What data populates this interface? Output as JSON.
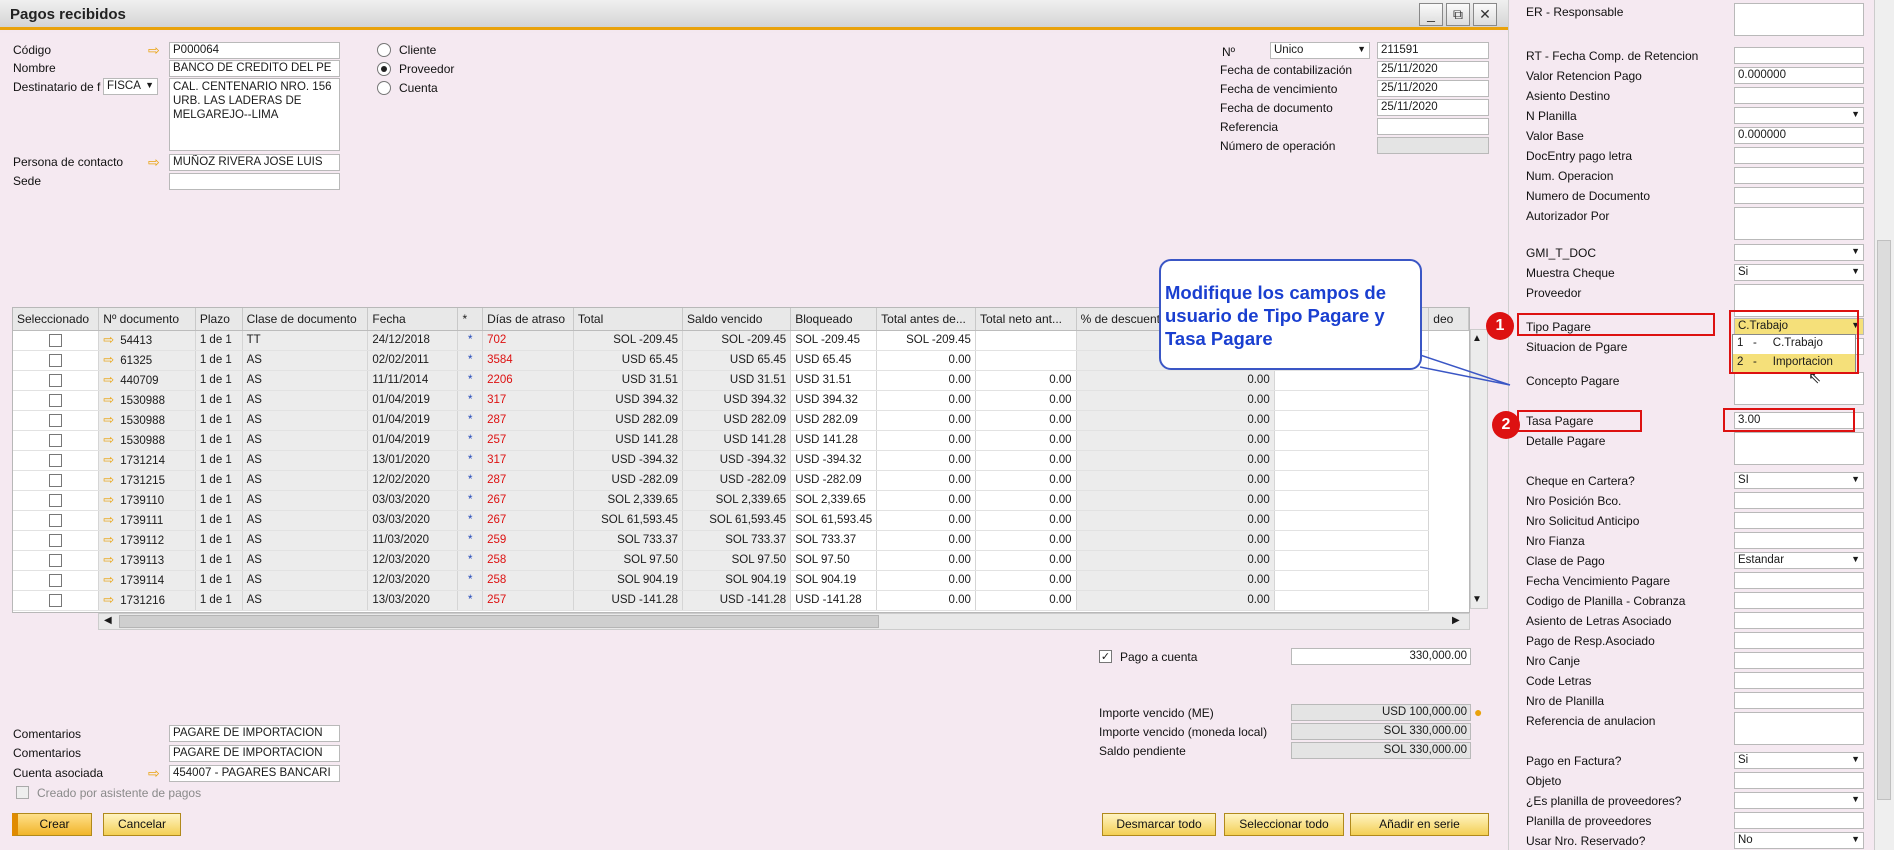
{
  "window": {
    "title": "Pagos recibidos",
    "minimize": "_",
    "restore": "⧉",
    "close": "✕"
  },
  "header_left": {
    "codigo_label": "Código",
    "codigo_value": "P000064",
    "nombre_label": "Nombre",
    "nombre_value": "BANCO DE CREDITO DEL PE",
    "destinatario_label": "Destinatario de f",
    "destinatario_select": "FISCA",
    "address_lines": [
      "CAL. CENTENARIO NRO. 156",
      "URB. LAS LADERAS DE",
      "MELGAREJO--LIMA"
    ],
    "contacto_label": "Persona de contacto",
    "contacto_value": "MUÑOZ RIVERA JOSE LUIS",
    "sede_label": "Sede",
    "sede_value": ""
  },
  "radios": {
    "cliente": "Cliente",
    "proveedor": "Proveedor",
    "cuenta": "Cuenta"
  },
  "header_right": {
    "no_label": "Nº",
    "serie_select": "Unico",
    "no_value": "211591",
    "fecha_contab_label": "Fecha de contabilización",
    "fecha_contab_value": "25/11/2020",
    "fecha_venc_label": "Fecha de vencimiento",
    "fecha_venc_value": "25/11/2020",
    "fecha_doc_label": "Fecha de documento",
    "fecha_doc_value": "25/11/2020",
    "referencia_label": "Referencia",
    "referencia_value": "",
    "num_oper_label": "Número de operación",
    "num_oper_value": ""
  },
  "grid": {
    "headers": [
      "Seleccionado",
      "Nº documento",
      "Plazo",
      "Clase de documento",
      "Fecha",
      "*",
      "Días de atraso",
      "Total",
      "Saldo vencido",
      "Bloqueado",
      "Total antes de...",
      "Total neto ant...",
      "% de descuento",
      "",
      "deo"
    ],
    "rows": [
      [
        "54413",
        "1 de 1",
        "TT",
        "24/12/2018",
        "*",
        "702",
        "SOL -209.45",
        "SOL -209.45",
        "SOL -209.45",
        "SOL -209.45",
        "",
        ""
      ],
      [
        "61325",
        "1 de 1",
        "AS",
        "02/02/2011",
        "*",
        "3584",
        "USD 65.45",
        "USD 65.45",
        "USD 65.45",
        "0.00",
        "",
        "0.00"
      ],
      [
        "440709",
        "1 de 1",
        "AS",
        "11/11/2014",
        "*",
        "2206",
        "USD 31.51",
        "USD 31.51",
        "USD 31.51",
        "0.00",
        "0.00",
        "0.00"
      ],
      [
        "1530988",
        "1 de 1",
        "AS",
        "01/04/2019",
        "*",
        "317",
        "USD 394.32",
        "USD 394.32",
        "USD 394.32",
        "0.00",
        "0.00",
        "0.00"
      ],
      [
        "1530988",
        "1 de 1",
        "AS",
        "01/04/2019",
        "*",
        "287",
        "USD 282.09",
        "USD 282.09",
        "USD 282.09",
        "0.00",
        "0.00",
        "0.00"
      ],
      [
        "1530988",
        "1 de 1",
        "AS",
        "01/04/2019",
        "*",
        "257",
        "USD 141.28",
        "USD 141.28",
        "USD 141.28",
        "0.00",
        "0.00",
        "0.00"
      ],
      [
        "1731214",
        "1 de 1",
        "AS",
        "13/01/2020",
        "*",
        "317",
        "USD -394.32",
        "USD -394.32",
        "USD -394.32",
        "0.00",
        "0.00",
        "0.00"
      ],
      [
        "1731215",
        "1 de 1",
        "AS",
        "12/02/2020",
        "*",
        "287",
        "USD -282.09",
        "USD -282.09",
        "USD -282.09",
        "0.00",
        "0.00",
        "0.00"
      ],
      [
        "1739110",
        "1 de 1",
        "AS",
        "03/03/2020",
        "*",
        "267",
        "SOL 2,339.65",
        "SOL 2,339.65",
        "SOL 2,339.65",
        "0.00",
        "0.00",
        "0.00"
      ],
      [
        "1739111",
        "1 de 1",
        "AS",
        "03/03/2020",
        "*",
        "267",
        "SOL 61,593.45",
        "SOL 61,593.45",
        "SOL 61,593.45",
        "0.00",
        "0.00",
        "0.00"
      ],
      [
        "1739112",
        "1 de 1",
        "AS",
        "11/03/2020",
        "*",
        "259",
        "SOL 733.37",
        "SOL 733.37",
        "SOL 733.37",
        "0.00",
        "0.00",
        "0.00"
      ],
      [
        "1739113",
        "1 de 1",
        "AS",
        "12/03/2020",
        "*",
        "258",
        "SOL 97.50",
        "SOL 97.50",
        "SOL 97.50",
        "0.00",
        "0.00",
        "0.00"
      ],
      [
        "1739114",
        "1 de 1",
        "AS",
        "12/03/2020",
        "*",
        "258",
        "SOL 904.19",
        "SOL 904.19",
        "SOL 904.19",
        "0.00",
        "0.00",
        "0.00"
      ],
      [
        "1731216",
        "1 de 1",
        "AS",
        "13/03/2020",
        "*",
        "257",
        "USD -141.28",
        "USD -141.28",
        "USD -141.28",
        "0.00",
        "0.00",
        "0.00"
      ]
    ]
  },
  "pago_a_cuenta": {
    "label": "Pago a cuenta",
    "value": "330,000.00"
  },
  "totals": {
    "importe_me_label": "Importe vencido (ME)",
    "importe_me_value": "USD 100,000.00",
    "importe_ml_label": "Importe vencido (moneda local)",
    "importe_ml_value": "SOL 330,000.00",
    "saldo_label": "Saldo pendiente",
    "saldo_value": "SOL 330,000.00"
  },
  "footer_left": {
    "comentarios_label": "Comentarios",
    "comentarios1_value": "PAGARE DE IMPORTACION",
    "comentarios2_value": "PAGARE DE IMPORTACION",
    "cuenta_label": "Cuenta asociada",
    "cuenta_value": "454007 - PAGARES BANCARI",
    "asistente_label": "Creado por asistente de pagos"
  },
  "buttons": {
    "crear": "Crear",
    "cancelar": "Cancelar",
    "desmarcar": "Desmarcar todo",
    "seleccionar": "Seleccionar todo",
    "anadir": "Añadir en serie"
  },
  "callout": {
    "text": "Modifique los campos de usuario de Tipo Pagare y Tasa Pagare",
    "badge1": "1",
    "badge2": "2"
  },
  "right_panel": {
    "fields": [
      {
        "label": "ER - Responsable",
        "value": "",
        "type": "tall"
      },
      {
        "label": "RT - Fecha Comp. de Retencion",
        "value": "",
        "type": "text"
      },
      {
        "label": "Valor Retencion Pago",
        "value": "0.000000",
        "type": "text"
      },
      {
        "label": "Asiento Destino",
        "value": "",
        "type": "text"
      },
      {
        "label": "N Planilla",
        "value": "",
        "type": "select"
      },
      {
        "label": "Valor Base",
        "value": "0.000000",
        "type": "text"
      },
      {
        "label": "DocEntry pago letra",
        "value": "",
        "type": "text"
      },
      {
        "label": "Num. Operacion",
        "value": "",
        "type": "text"
      },
      {
        "label": "Numero de Documento",
        "value": "",
        "type": "text"
      },
      {
        "label": "Autorizador Por",
        "value": "",
        "type": "tall"
      },
      {
        "label": "GMI_T_DOC",
        "value": "",
        "type": "select"
      },
      {
        "label": "Muestra Cheque",
        "value": "Si",
        "type": "select"
      },
      {
        "label": "Proveedor",
        "value": "",
        "type": "tall"
      },
      {
        "label": "Tipo Pagare",
        "value": "C.Trabajo",
        "type": "select"
      },
      {
        "label": "Situacion de Pgare",
        "value": "",
        "type": "text"
      },
      {
        "label": "Concepto Pagare",
        "value": "",
        "type": "tall"
      },
      {
        "label": "Tasa Pagare",
        "value": "3.00",
        "type": "text"
      },
      {
        "label": "Detalle Pagare",
        "value": "",
        "type": "tall"
      },
      {
        "label": "Cheque en Cartera?",
        "value": "SI",
        "type": "select"
      },
      {
        "label": "Nro Posición Bco.",
        "value": "",
        "type": "text"
      },
      {
        "label": "Nro Solicitud Anticipo",
        "value": "",
        "type": "text"
      },
      {
        "label": "Nro Fianza",
        "value": "",
        "type": "text"
      },
      {
        "label": "Clase de Pago",
        "value": "Estandar",
        "type": "select"
      },
      {
        "label": "Fecha Vencimiento Pagare",
        "value": "",
        "type": "text"
      },
      {
        "label": "Codigo de Planilla - Cobranza",
        "value": "",
        "type": "text"
      },
      {
        "label": "Asiento de Letras Asociado",
        "value": "",
        "type": "text"
      },
      {
        "label": "Pago de Resp.Asociado",
        "value": "",
        "type": "text"
      },
      {
        "label": "Nro Canje",
        "value": "",
        "type": "text"
      },
      {
        "label": "Code Letras",
        "value": "",
        "type": "text"
      },
      {
        "label": "Nro de Planilla",
        "value": "",
        "type": "text"
      },
      {
        "label": "Referencia de anulacion",
        "value": "",
        "type": "tall"
      },
      {
        "label": "Pago en Factura?",
        "value": "Si",
        "type": "select"
      },
      {
        "label": "Objeto",
        "value": "",
        "type": "text"
      },
      {
        "label": "¿Es planilla de proveedores?",
        "value": "",
        "type": "select"
      },
      {
        "label": "Planilla de proveedores",
        "value": "",
        "type": "text"
      },
      {
        "label": "Usar Nro. Reservado?",
        "value": "No",
        "type": "select"
      }
    ],
    "dropdown_options": [
      "1   -     C.Trabajo",
      "2   -     Importacion"
    ]
  }
}
